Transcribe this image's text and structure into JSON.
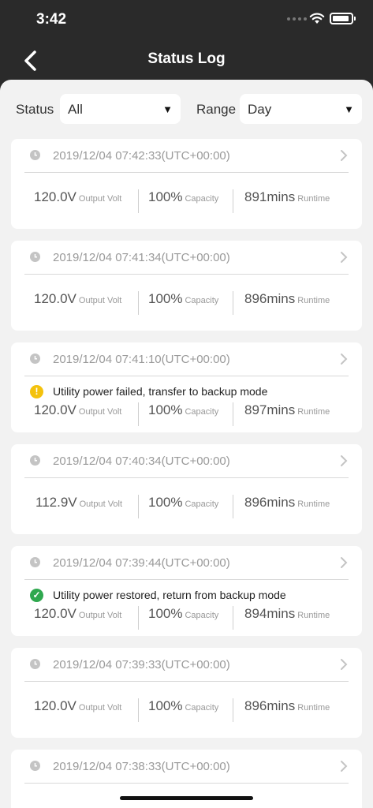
{
  "status_bar": {
    "time": "3:42"
  },
  "nav": {
    "title": "Status Log"
  },
  "filters": {
    "status_label": "Status",
    "status_value": "All",
    "range_label": "Range",
    "range_value": "Day"
  },
  "colors": {
    "warning": "#f4c20d",
    "success": "#2fa84f",
    "header_bg": "#2a2a2a",
    "content_bg": "#f2f2f2"
  },
  "metric_labels": {
    "volt": "Output Volt",
    "capacity": "Capacity",
    "runtime": "Runtime"
  },
  "logs": [
    {
      "time": "2019/12/04 07:42:33(UTC+00:00)",
      "volt": "120.0V",
      "capacity": "100%",
      "runtime": "891mins"
    },
    {
      "time": "2019/12/04 07:41:34(UTC+00:00)",
      "volt": "120.0V",
      "capacity": "100%",
      "runtime": "896mins"
    },
    {
      "time": "2019/12/04 07:41:10(UTC+00:00)",
      "event": {
        "type": "warning",
        "icon": "warning-icon",
        "text": "Utility power failed, transfer to backup mode"
      },
      "volt": "120.0V",
      "capacity": "100%",
      "runtime": "897mins"
    },
    {
      "time": "2019/12/04 07:40:34(UTC+00:00)",
      "volt": "112.9V",
      "capacity": "100%",
      "runtime": "896mins"
    },
    {
      "time": "2019/12/04 07:39:44(UTC+00:00)",
      "event": {
        "type": "success",
        "icon": "check-icon",
        "text": "Utility power restored, return from backup mode"
      },
      "volt": "120.0V",
      "capacity": "100%",
      "runtime": "894mins"
    },
    {
      "time": "2019/12/04 07:39:33(UTC+00:00)",
      "volt": "120.0V",
      "capacity": "100%",
      "runtime": "896mins"
    },
    {
      "time": "2019/12/04 07:38:33(UTC+00:00)"
    }
  ]
}
